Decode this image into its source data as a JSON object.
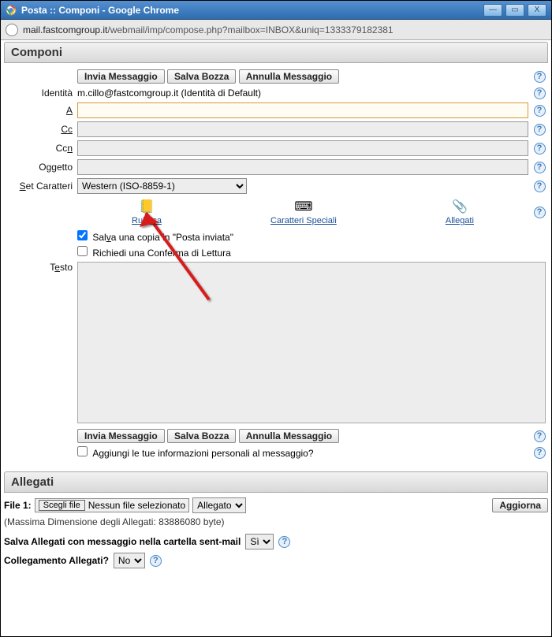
{
  "window": {
    "title": "Posta :: Componi - Google Chrome"
  },
  "address": {
    "host": "mail.fastcomgroup.it",
    "path": "/webmail/imp/compose.php?mailbox=INBOX&uniq=1333379182381"
  },
  "headers": {
    "compose": "Componi",
    "attachments": "Allegati"
  },
  "buttons": {
    "send": "Invia Messaggio",
    "save_draft": "Salva Bozza",
    "cancel": "Annulla Messaggio",
    "refresh": "Aggiorna",
    "choose_file": "Scegli file"
  },
  "labels": {
    "identity": "Identità",
    "to": "A",
    "cc": "Cc",
    "bcc": "Ccn",
    "subject": "Oggetto",
    "charset": "Set Caratteri",
    "text": "Testo",
    "file1": "File 1:"
  },
  "identity": {
    "value": "m.cillo@fastcomgroup.it (Identità di Default)"
  },
  "fields": {
    "to": "",
    "cc": "",
    "bcc": "",
    "subject": "",
    "body": ""
  },
  "charset": {
    "selected": "Western (ISO-8859-1)"
  },
  "tools": {
    "addressbook": "Rubrica",
    "special_chars": "Caratteri Speciali",
    "attachments": "Allegati"
  },
  "checkboxes": {
    "save_sent": {
      "label": "Salva una copia in \"Posta inviata\"",
      "checked": true
    },
    "read_receipt": {
      "label": "Richiedi una Conferma di Lettura",
      "checked": false
    },
    "add_personal_info": {
      "label": "Aggiungi le tue informazioni personali al messaggio?",
      "checked": false
    }
  },
  "attachments": {
    "no_file": "Nessun file selezionato",
    "disposition_label": "Allegato",
    "max_size_note": "(Massima Dimensione degli Allegati: 83886080 byte)",
    "save_with_msg_label": "Salva Allegati con messaggio nella cartella sent-mail",
    "save_with_msg_value": "Sì",
    "link_label": "Collegamento Allegati?",
    "link_value": "No"
  }
}
